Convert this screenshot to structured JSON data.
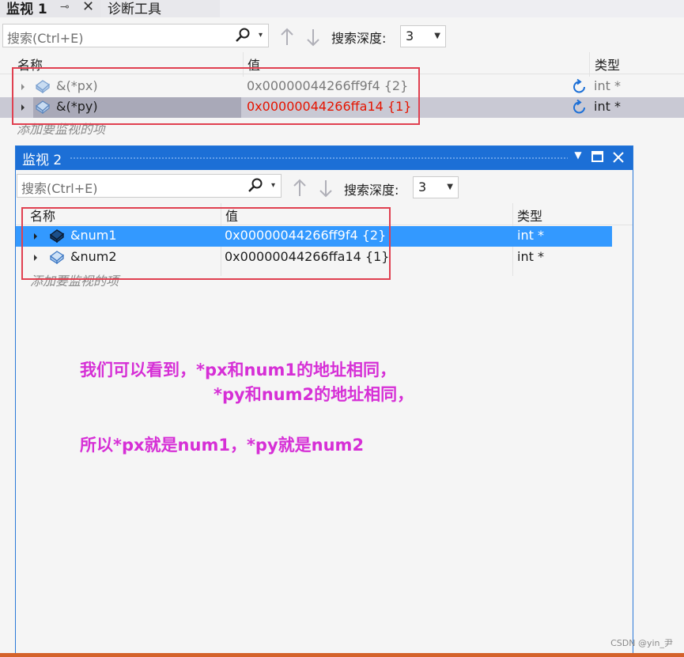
{
  "watch1": {
    "tab_title": "监视 1",
    "pin_glyph": "⊸",
    "close_glyph": "✕",
    "tab2_title": "诊断工具",
    "search_placeholder": "搜索(Ctrl+E)",
    "depth_label": "搜索深度:",
    "depth_value": "3",
    "columns": {
      "name": "名称",
      "value": "值",
      "type": "类型"
    },
    "rows": [
      {
        "name": "&(*px)",
        "value": "0x00000044266ff9f4 {2}",
        "type": "int *"
      },
      {
        "name": "&(*py)",
        "value": "0x00000044266ffa14 {1}",
        "type": "int *"
      }
    ],
    "add_watch": "添加要监视的项"
  },
  "watch2": {
    "title": "监视 2",
    "search_placeholder": "搜索(Ctrl+E)",
    "depth_label": "搜索深度:",
    "depth_value": "3",
    "columns": {
      "name": "名称",
      "value": "值",
      "type": "类型"
    },
    "rows": [
      {
        "name": "&num1",
        "value": "0x00000044266ff9f4 {2}",
        "type": "int *"
      },
      {
        "name": "&num2",
        "value": "0x00000044266ffa14 {1}",
        "type": "int *"
      }
    ],
    "add_watch": "添加要监视的项"
  },
  "annotation": {
    "line1": "我们可以看到，*px和num1的地址相同，",
    "line2": "*py和num2的地址相同，",
    "line3": "所以*px就是num1，*py就是num2"
  },
  "watermark": "CSDN @yin_尹",
  "colors": {
    "selection": "#3399ff",
    "changed_value": "#e51400",
    "annotation": "#d62fd6",
    "highlight_box": "#e04050",
    "title_bar": "#1c6fd6"
  }
}
